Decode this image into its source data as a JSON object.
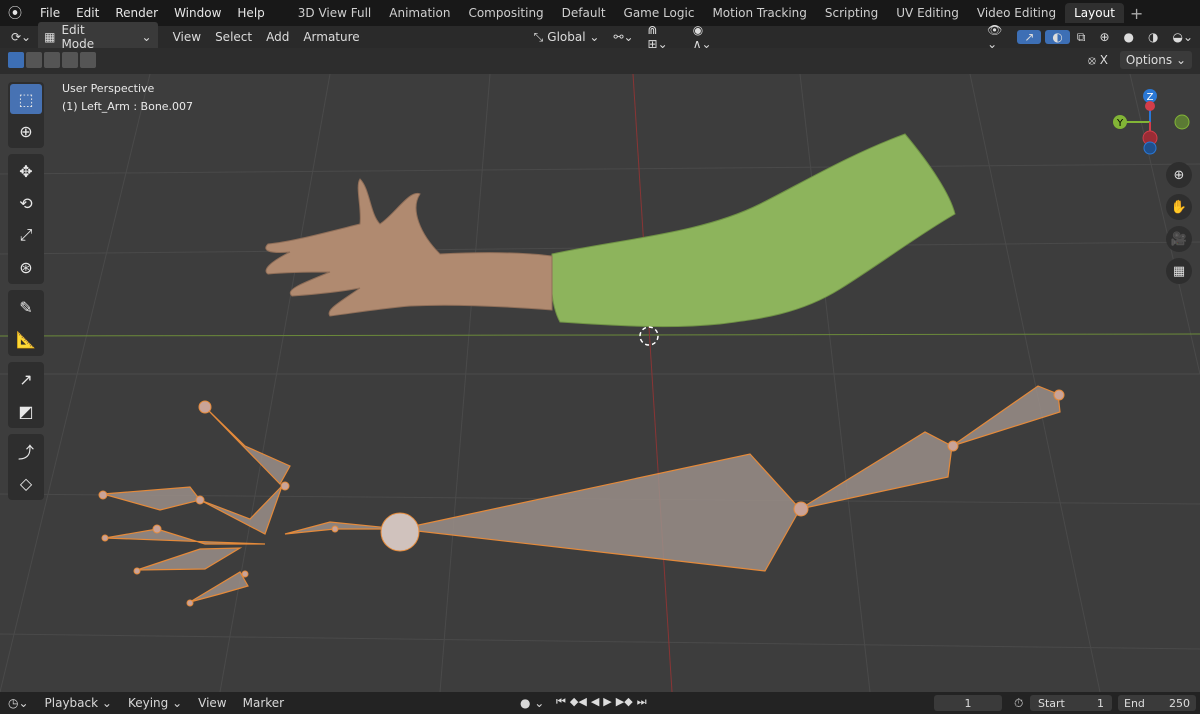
{
  "menu": {
    "logo_icon": "blender-logo-icon",
    "items": [
      "File",
      "Edit",
      "Render",
      "Window",
      "Help"
    ]
  },
  "workspaces": {
    "tabs": [
      "3D View Full",
      "Animation",
      "Compositing",
      "Default",
      "Game Logic",
      "Motion Tracking",
      "Scripting",
      "UV Editing",
      "Video Editing",
      "Layout"
    ],
    "active": "Layout"
  },
  "header": {
    "mode": "Edit Mode",
    "menus": [
      "View",
      "Select",
      "Add",
      "Armature"
    ],
    "orientation": "Global",
    "options_label": "Options"
  },
  "viewport": {
    "perspective": "User Perspective",
    "object_info": "(1) Left_Arm : Bone.007",
    "gizmo": {
      "z": "Z",
      "y": "Y",
      "x_color": "#d33d4a",
      "y_color": "#82b536",
      "z_color": "#2a78d6"
    },
    "colors": {
      "background": "#3d3d3d",
      "sleeve": "#8db45c",
      "skin": "#b08a70",
      "bone": "#9a8e88",
      "bone_outline": "#e58a3a"
    }
  },
  "toolbar": {
    "tools": [
      "select-box-icon",
      "cursor-icon",
      "move-icon",
      "rotate-icon",
      "scale-icon",
      "transform-icon",
      "annotate-icon",
      "measure-icon",
      "roll-icon",
      "bone-size-icon",
      "extrude-icon",
      "envelope-icon"
    ]
  },
  "timeline": {
    "menus": [
      "Playback",
      "Keying",
      "View",
      "Marker"
    ],
    "current_frame": "1",
    "start_label": "Start",
    "start": "1",
    "end_label": "End",
    "end": "250"
  }
}
